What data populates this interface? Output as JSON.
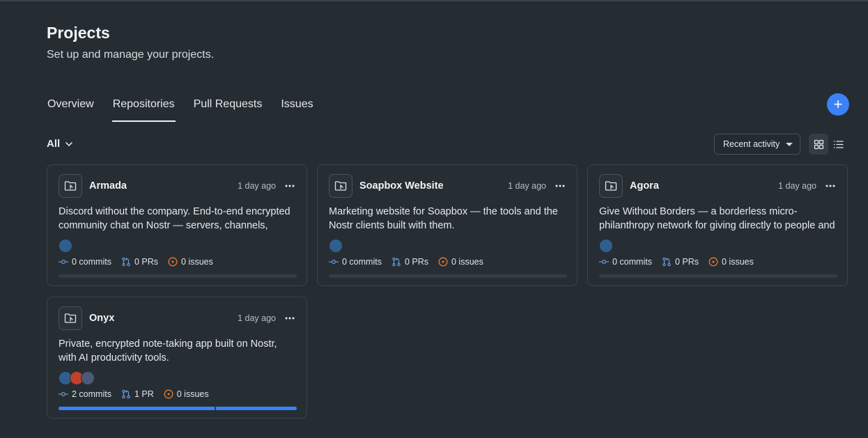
{
  "header": {
    "title": "Projects",
    "subtitle": "Set up and manage your projects."
  },
  "tabs": [
    {
      "label": "Overview",
      "active": false
    },
    {
      "label": "Repositories",
      "active": true
    },
    {
      "label": "Pull Requests",
      "active": false
    },
    {
      "label": "Issues",
      "active": false
    }
  ],
  "toolbar": {
    "filter_label": "All",
    "sort_label": "Recent activity",
    "add_label": "+"
  },
  "colors": {
    "accent": "#3b82f6",
    "issue": "#e8792b",
    "background": "#252d33"
  },
  "repos": [
    {
      "name": "Armada",
      "time": "1 day ago",
      "description": "Discord without the company. End-to-end encrypted community chat on Nostr — servers, channels, threads, voice and moderation, no host.",
      "avatars": [
        "#2f5f8f"
      ],
      "commits": "0 commits",
      "prs": "0 PRs",
      "issues": "0 issues",
      "progress": [
        0,
        0
      ]
    },
    {
      "name": "Soapbox Website",
      "time": "1 day ago",
      "description": "Marketing website for Soapbox — the tools and the Nostr clients built with them.",
      "avatars": [
        "#2f5f8f"
      ],
      "commits": "0 commits",
      "prs": "0 PRs",
      "issues": "0 issues",
      "progress": [
        0,
        0
      ]
    },
    {
      "name": "Agora",
      "time": "1 day ago",
      "description": "Give Without Borders — a borderless micro-philanthropy network for giving directly to people and causes anywhere, powered by Bitcoin and Nostr.",
      "avatars": [
        "#2f5f8f"
      ],
      "commits": "0 commits",
      "prs": "0 PRs",
      "issues": "0 issues",
      "progress": [
        0,
        0
      ]
    },
    {
      "name": "Onyx",
      "time": "1 day ago",
      "description": "Private, encrypted note-taking app built on Nostr, with AI productivity tools.",
      "avatars": [
        "#2f5f8f",
        "#c2412d",
        "#4a5a78"
      ],
      "commits": "2 commits",
      "prs": "1 PR",
      "issues": "0 issues",
      "progress": [
        0.66,
        0.34
      ]
    }
  ]
}
